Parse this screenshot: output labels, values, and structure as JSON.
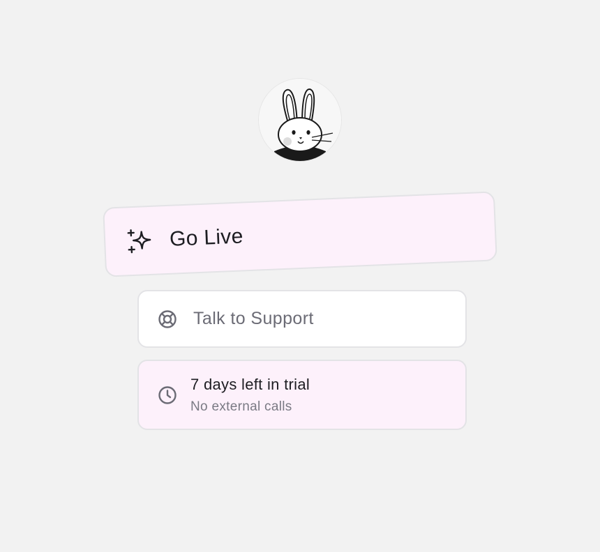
{
  "avatar": {
    "icon": "bunny-avatar-icon"
  },
  "go_live": {
    "label": "Go Live",
    "icon": "sparkles-icon"
  },
  "support": {
    "label": "Talk to Support",
    "icon": "lifebuoy-icon"
  },
  "trial": {
    "title": "7 days left in trial",
    "subtitle": "No external calls",
    "icon": "clock-icon"
  },
  "colors": {
    "background": "#f2f2f2",
    "pink_card": "#fdf1fb",
    "white_card": "#ffffff",
    "border": "#e3e3e6",
    "text_dark": "#1d1d22",
    "text_muted": "#6b6b75"
  }
}
